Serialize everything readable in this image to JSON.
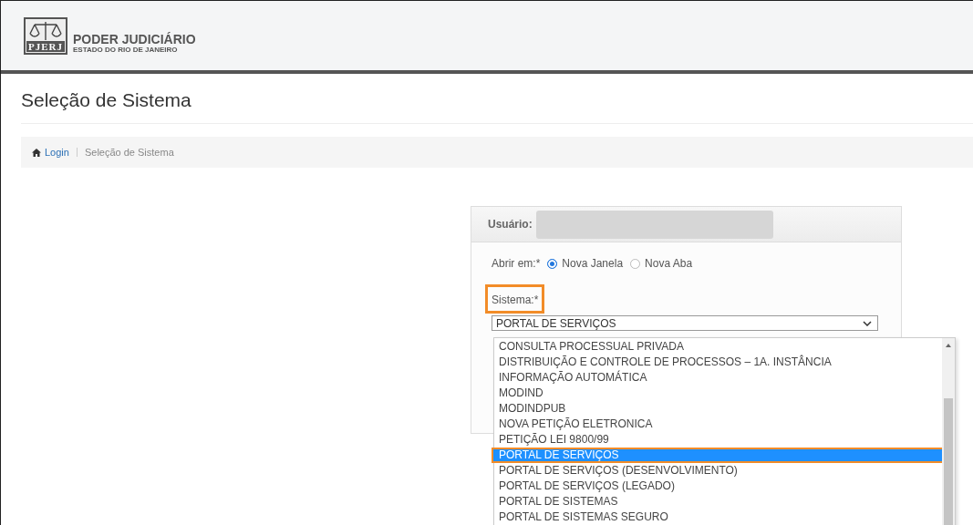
{
  "header": {
    "logo_mark": "PJERJ",
    "org_name": "PODER JUDICIÁRIO",
    "org_sub": "ESTADO DO RIO DE JANEIRO"
  },
  "page_title": "Seleção de Sistema",
  "breadcrumb": [
    {
      "label": "Login",
      "kind": "link"
    },
    {
      "label": "Seleção de Sistema",
      "kind": "current"
    }
  ],
  "panel": {
    "user_label": "Usuário:",
    "open_in": {
      "label": "Abrir em:",
      "required": "*",
      "options": [
        {
          "label": "Nova Janela",
          "selected": true
        },
        {
          "label": "Nova Aba",
          "selected": false
        }
      ]
    },
    "system": {
      "label": "Sistema:",
      "required": "*",
      "value": "PORTAL DE SERVIÇOS",
      "highlighted": true,
      "options": [
        {
          "label": "CONSULTA PROCESSUAL PRIVADA",
          "selected": false
        },
        {
          "label": "DISTRIBUIÇÃO E CONTROLE DE PROCESSOS – 1A. INSTÂNCIA",
          "selected": false
        },
        {
          "label": "INFORMAÇÃO AUTOMÁTICA",
          "selected": false
        },
        {
          "label": "MODIND",
          "selected": false
        },
        {
          "label": "MODINDPUB",
          "selected": false
        },
        {
          "label": "NOVA PETIÇÃO ELETRONICA",
          "selected": false
        },
        {
          "label": "PETIÇÃO LEI 9800/99",
          "selected": false
        },
        {
          "label": "PORTAL DE SERVIÇOS",
          "selected": true
        },
        {
          "label": "PORTAL DE SERVIÇOS (DESENVOLVIMENTO)",
          "selected": false
        },
        {
          "label": "PORTAL DE SERVIÇOS (LEGADO)",
          "selected": false
        },
        {
          "label": "PORTAL DE SISTEMAS",
          "selected": false
        },
        {
          "label": "PORTAL DE SISTEMAS SEGURO",
          "selected": false
        }
      ]
    }
  }
}
